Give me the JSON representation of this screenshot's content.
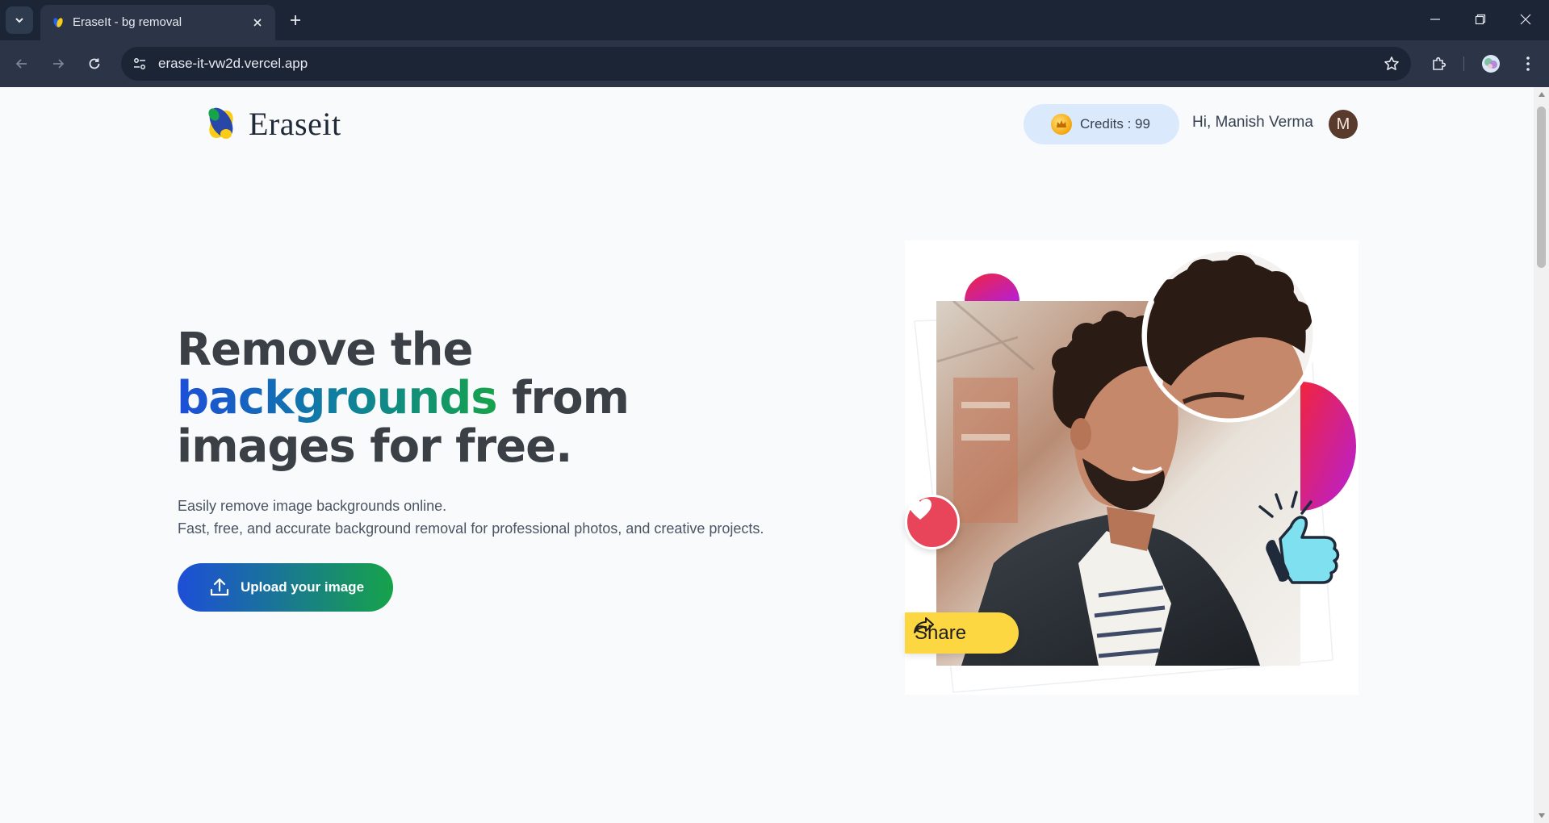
{
  "browser": {
    "tab_title": "EraseIt - bg removal",
    "url": "erase-it-vw2d.vercel.app"
  },
  "header": {
    "brand": "Eraseit",
    "credits": "Credits : 99",
    "greeting": "Hi, Manish Verma",
    "avatar_initial": "M"
  },
  "hero": {
    "title_line1": "Remove the",
    "title_highlight": "backgrounds",
    "title_line2_rest": " from",
    "title_line3": "images for free.",
    "subtitle_line1": "Easily remove image backgrounds online.",
    "subtitle_line2": "Fast, free, and accurate background removal for professional photos, and creative projects.",
    "upload_label": "Upload your image"
  },
  "illustration": {
    "share_label": "Share"
  },
  "colors": {
    "brand_gradient_start": "#1d4ed8",
    "brand_gradient_end": "#16a34a",
    "credits_bg": "#dbe9fd",
    "heart": "#e8455b",
    "share": "#fcd742"
  }
}
